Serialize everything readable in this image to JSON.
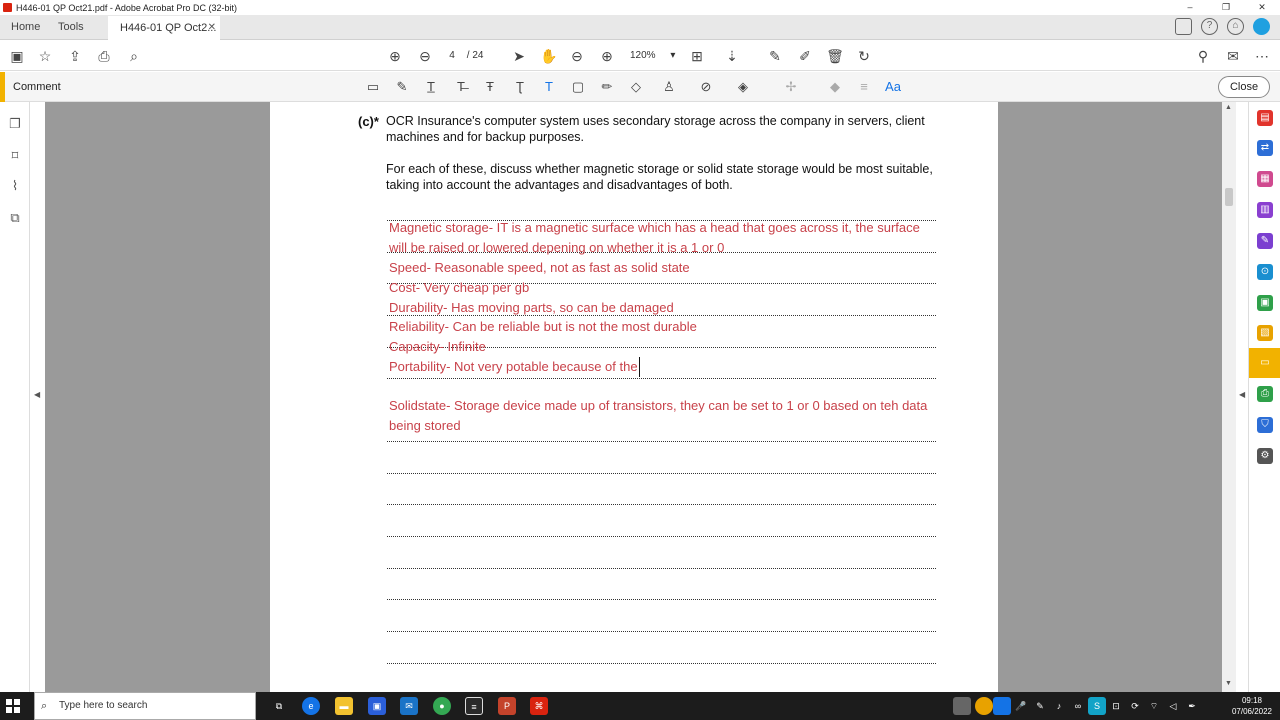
{
  "window": {
    "title": "H446-01 QP Oct21.pdf - Adobe Acrobat Pro DC (32-bit)",
    "min": "–",
    "max": "❐",
    "close": "✕"
  },
  "tabs": {
    "home": "Home",
    "tools": "Tools",
    "doc": "H446-01 QP Oct2...",
    "doc_close": "✕"
  },
  "toolbar": {
    "page_current": "4",
    "page_total": "/ 24",
    "zoom": "120%",
    "zoom_arrow": "▾"
  },
  "comment_bar": {
    "label": "Comment",
    "close": "Close",
    "font_icon": "Aa"
  },
  "document": {
    "question_number": "(c)*",
    "question_text": "OCR Insurance's computer system uses secondary storage across the company in servers, client machines and for backup purposes.",
    "question_text2": "For each of these, discuss whether magnetic storage or solid state storage would be most suitable, taking into account the advantages and disadvantages of both.",
    "answer_lines": [
      "Magnetic storage- IT is a magnetic surface which has a head that goes across it, the surface",
      "will be raised or lowered depening on whether it is a 1 or 0",
      "Speed- Reasonable speed, not as fast as solid state",
      "Cost- Very cheap per gb",
      "Durability- Has moving parts, so can be damaged",
      "Reliability- Can be reliable but is not the most durable",
      "Capacity- Infinite",
      "Portability- Not very potable because of the",
      "Solidstate- Storage device made up of transistors, they can be set to 1 or 0 based on teh data",
      "being stored"
    ]
  },
  "taskbar": {
    "search_placeholder": "Type here to search",
    "time": "09:18",
    "date": "07/06/2022"
  },
  "colors": {
    "accent": "#f2b200",
    "annotation_red": "#c8424a",
    "taskbar": "#1c1c1c"
  }
}
